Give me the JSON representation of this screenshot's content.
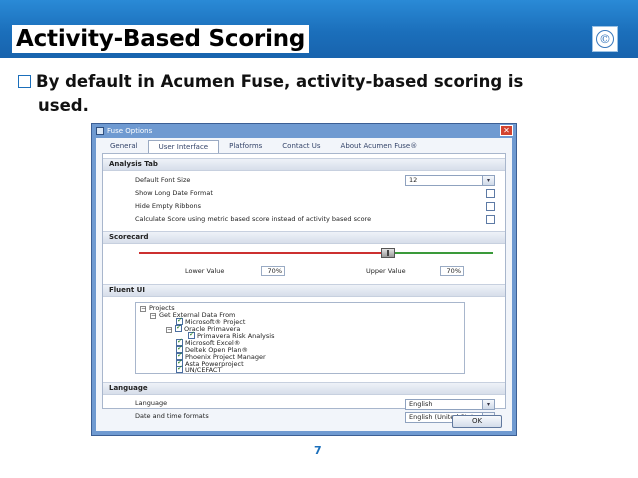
{
  "slide": {
    "title": "Activity-Based Scoring",
    "bullet_line1": "By default in Acumen Fuse, activity-based scoring is",
    "bullet_line2": "used.",
    "page_number": "7",
    "icon": "copyright-icon",
    "colors": {
      "header": "#1b6fbb",
      "accent": "#1b6fbb"
    }
  },
  "dialog": {
    "title": "Fuse Options",
    "close_label": "✕",
    "tabs": [
      {
        "label": "General",
        "active": false
      },
      {
        "label": "User Interface",
        "active": true
      },
      {
        "label": "Platforms",
        "active": false
      },
      {
        "label": "Contact Us",
        "active": false
      },
      {
        "label": "About Acumen Fuse®",
        "active": false
      }
    ],
    "analysis_tab": {
      "heading": "Analysis Tab",
      "font_size_label": "Default Font Size",
      "font_size_value": "12",
      "long_date_label": "Show Long Date Format",
      "hide_ribbons_label": "Hide Empty Ribbons",
      "calc_score_label": "Calculate Score using metric based score instead of activity based score"
    },
    "scorecard": {
      "heading": "Scorecard",
      "lower_label": "Lower Value",
      "lower_value": "70%",
      "upper_label": "Upper Value",
      "upper_value": "70%"
    },
    "fluent_ui": {
      "heading": "Fluent UI",
      "tree": [
        {
          "label": "Projects",
          "expander": "⊟"
        },
        {
          "label": "Get External Data From",
          "expander": "⊟"
        },
        {
          "label": "Microsoft® Project"
        },
        {
          "label": "Oracle Primavera",
          "expander": "⊟"
        },
        {
          "label": "Primavera Risk Analysis"
        },
        {
          "label": "Microsoft Excel®"
        },
        {
          "label": "Deltek Open Plan®"
        },
        {
          "label": "Phoenix Project Manager"
        },
        {
          "label": "Asta Powerproject"
        },
        {
          "label": "UN/CEFACT"
        }
      ]
    },
    "language": {
      "heading": "Language",
      "language_label": "Language",
      "language_value": "English",
      "datetime_label": "Date and time formats",
      "datetime_value": "English (United States"
    },
    "ok_label": "OK"
  }
}
